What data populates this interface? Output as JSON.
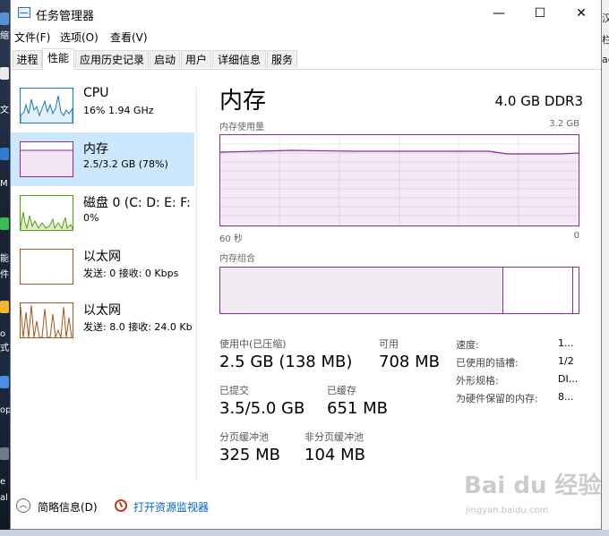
{
  "window": {
    "title": "任务管理器",
    "controls": {
      "minimize": "—",
      "maximize": "☐",
      "close": "✕"
    }
  },
  "menu": [
    "文件(F)",
    "选项(O)",
    "查看(V)"
  ],
  "tabs": [
    "进程",
    "性能",
    "应用历史记录",
    "启动",
    "用户",
    "详细信息",
    "服务"
  ],
  "active_tab": "性能",
  "sidebar": {
    "items": [
      {
        "name": "CPU",
        "value": "16%  1.94 GHz",
        "color": "#1a7ab8"
      },
      {
        "name": "内存",
        "value": "2.5/3.2 GB (78%)",
        "color": "#8b2d9b"
      },
      {
        "name": "磁盘 0 (C: D: E: F:",
        "value": "0%",
        "color": "#4ca30a"
      },
      {
        "name": "以太网",
        "value": "发送: 0 接收: 0 Kbps",
        "color": "#a7541a"
      },
      {
        "name": "以太网",
        "value": "发送: 8.0  接收: 24.0 Kb",
        "color": "#a7541a"
      }
    ]
  },
  "detail": {
    "title": "内存",
    "spec": "4.0 GB DDR3",
    "usage_label": "内存使用量",
    "usage_max": "3.2 GB",
    "time_left": "60 秒",
    "time_right": "0",
    "composition_label": "内存组合",
    "stats": {
      "in_use_label": "使用中(已压缩)",
      "in_use": "2.5 GB (138 MB)",
      "available_label": "可用",
      "available": "708 MB",
      "committed_label": "已提交",
      "committed": "3.5/5.0 GB",
      "cached_label": "已缓存",
      "cached": "651 MB",
      "paged_label": "分页缓冲池",
      "paged": "325 MB",
      "nonpaged_label": "非分页缓冲池",
      "nonpaged": "104 MB"
    },
    "props": [
      {
        "k": "速度:",
        "v": "1..."
      },
      {
        "k": "已使用的插槽:",
        "v": "1/2"
      },
      {
        "k": "外形规格:",
        "v": "DI..."
      },
      {
        "k": "为硬件保留的内存:",
        "v": "8..."
      }
    ]
  },
  "footer": {
    "fewer_details": "简略信息(D)",
    "resource_monitor": "打开资源监视器"
  },
  "watermark": {
    "logo": "Bai du 经验",
    "url": "jingyan.baidu.com"
  },
  "desktop_left": [
    "缩",
    "文",
    "M",
    "能",
    "件",
    "o",
    "式",
    "op",
    "e",
    "al"
  ],
  "desktop_right": [
    "汉",
    "栏",
    "ac"
  ]
}
